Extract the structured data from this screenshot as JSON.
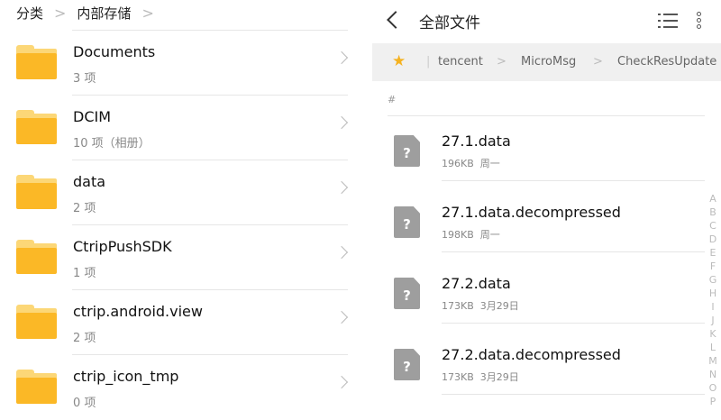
{
  "left": {
    "breadcrumb": [
      "分类",
      "内部存储"
    ],
    "folders": [
      {
        "name": "Documents",
        "sub": "3 项"
      },
      {
        "name": "DCIM",
        "sub": "10 项（相册）"
      },
      {
        "name": "data",
        "sub": "2 项"
      },
      {
        "name": "CtripPushSDK",
        "sub": "1 项"
      },
      {
        "name": "ctrip.android.view",
        "sub": "2 项"
      },
      {
        "name": "ctrip_icon_tmp",
        "sub": "0 项"
      }
    ]
  },
  "right": {
    "title": "全部文件",
    "path": [
      "tencent",
      "MicroMsg",
      "CheckResUpdate"
    ],
    "section": "#",
    "files": [
      {
        "name": "27.1.data",
        "size": "196KB",
        "date": "周一"
      },
      {
        "name": "27.1.data.decompressed",
        "size": "198KB",
        "date": "周一"
      },
      {
        "name": "27.2.data",
        "size": "173KB",
        "date": "3月29日"
      },
      {
        "name": "27.2.data.decompressed",
        "size": "173KB",
        "date": "3月29日"
      }
    ],
    "index": [
      "A",
      "B",
      "C",
      "D",
      "E",
      "F",
      "G",
      "H",
      "I",
      "J",
      "K",
      "L",
      "M",
      "N",
      "O",
      "P"
    ]
  }
}
